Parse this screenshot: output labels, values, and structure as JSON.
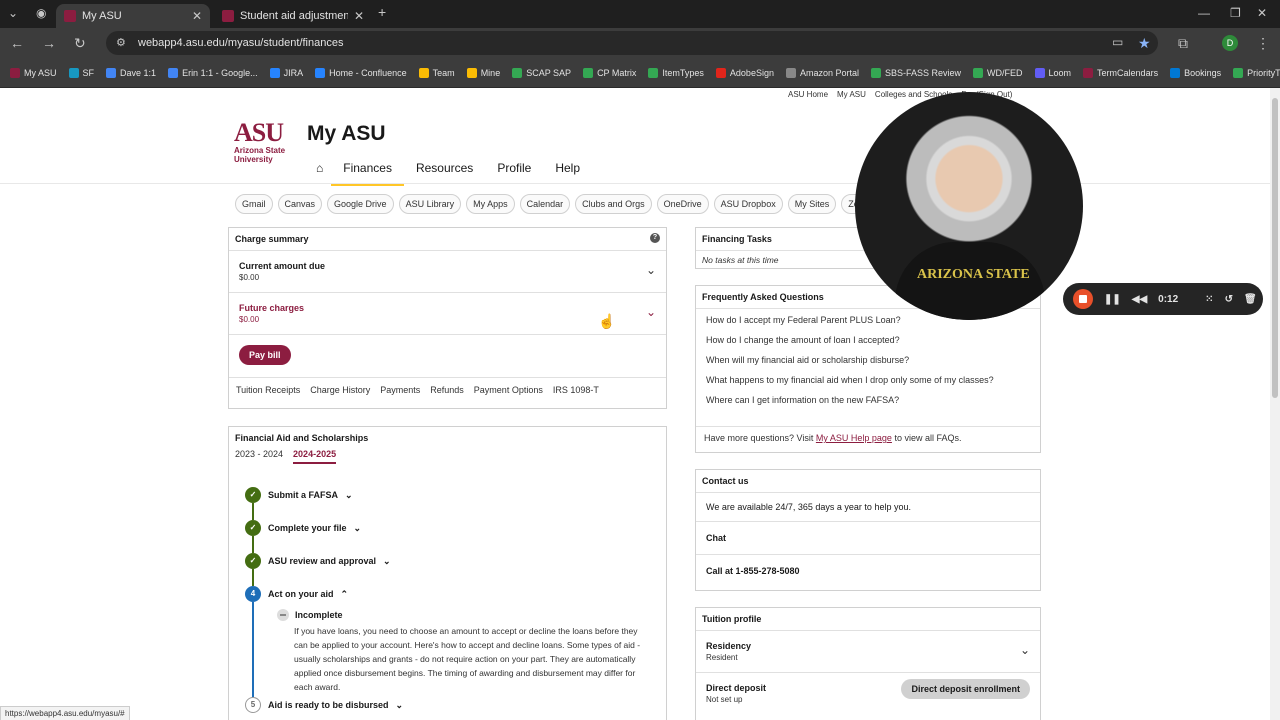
{
  "browser": {
    "tabs": [
      {
        "title": "My ASU",
        "active": true
      },
      {
        "title": "Student aid adjustment & re",
        "active": false
      }
    ],
    "new_tab": "+",
    "url": "webapp4.asu.edu/myasu/student/finances",
    "profile_initial": "D",
    "bookmarks": [
      {
        "label": "My ASU",
        "color": "#8c1d40"
      },
      {
        "label": "SF",
        "color": "#1798c1"
      },
      {
        "label": "Dave 1:1",
        "color": "#4285f4"
      },
      {
        "label": "Erin 1:1 - Google...",
        "color": "#4285f4"
      },
      {
        "label": "JIRA",
        "color": "#2684ff"
      },
      {
        "label": "Home - Confluence",
        "color": "#2684ff"
      },
      {
        "label": "Team",
        "color": "#fbbc04"
      },
      {
        "label": "Mine",
        "color": "#fbbc04"
      },
      {
        "label": "SCAP SAP",
        "color": "#34a853"
      },
      {
        "label": "CP Matrix",
        "color": "#34a853"
      },
      {
        "label": "ItemTypes",
        "color": "#34a853"
      },
      {
        "label": "AdobeSign",
        "color": "#e1251b"
      },
      {
        "label": "Amazon Portal",
        "color": "#888888"
      },
      {
        "label": "SBS-FASS Review",
        "color": "#34a853"
      },
      {
        "label": "WD/FED",
        "color": "#34a853"
      },
      {
        "label": "Loom",
        "color": "#625df5"
      },
      {
        "label": "TermCalendars",
        "color": "#8c1d40"
      },
      {
        "label": "Bookings",
        "color": "#0078d4"
      },
      {
        "label": "PriorityTickets",
        "color": "#34a853"
      }
    ],
    "status_url": "https://webapp4.asu.edu/myasu/#"
  },
  "page": {
    "top_links": [
      "ASU Home",
      "My ASU",
      "Colleges and Schools",
      "D... (Sign Out)"
    ],
    "logo": {
      "mark": "ASU",
      "line1": "Arizona State",
      "line2": "University"
    },
    "title": "My ASU",
    "nav": [
      "Finances",
      "Resources",
      "Profile",
      "Help"
    ],
    "pills": [
      "Gmail",
      "Canvas",
      "Google Drive",
      "ASU Library",
      "My Apps",
      "Calendar",
      "Clubs and Orgs",
      "OneDrive",
      "ASU Dropbox",
      "My Sites",
      "Ze"
    ]
  },
  "charge_summary": {
    "title": "Charge summary",
    "current_label": "Current amount due",
    "current_value": "$0.00",
    "future_label": "Future charges",
    "future_value": "$0.00",
    "pay_button": "Pay bill",
    "links": [
      "Tuition Receipts",
      "Charge History",
      "Payments",
      "Refunds",
      "Payment Options",
      "IRS 1098-T"
    ]
  },
  "aid": {
    "title": "Financial Aid and Scholarships",
    "years": [
      "2023 - 2024",
      "2024-2025"
    ],
    "steps": [
      {
        "label": "Submit a FAFSA",
        "state": "done",
        "glyph": "✓"
      },
      {
        "label": "Complete your file",
        "state": "done",
        "glyph": "✓"
      },
      {
        "label": "ASU review and approval",
        "state": "done",
        "glyph": "✓"
      },
      {
        "label": "Act on your aid",
        "state": "current",
        "glyph": "4"
      },
      {
        "label": "Aid is ready to be disbursed",
        "state": "todo",
        "glyph": "5"
      }
    ],
    "sub_status": "Incomplete",
    "sub_text": "If you have loans, you need to choose an amount to accept or decline the loans before they can be applied to your account. Here's how to accept and decline loans. Some types of aid - usually scholarships and grants - do not require action on your part. They are automatically applied once disbursement begins. The timing of awarding and disbursement may differ for each award."
  },
  "financing_tasks": {
    "title": "Financing Tasks",
    "empty": "No tasks at this time"
  },
  "faq": {
    "title": "Frequently Asked Questions",
    "questions": [
      "How do I accept my Federal Parent PLUS Loan?",
      "How do I change the amount of loan I accepted?",
      "When will my financial aid or scholarship disburse?",
      "What happens to my financial aid when I drop only some of my classes?",
      "Where can I get information on the new FAFSA?"
    ],
    "more_prefix": "Have more questions? Visit ",
    "more_link": "My ASU Help page",
    "more_suffix": " to view all FAQs."
  },
  "contact": {
    "title": "Contact us",
    "availability": "We are available 24/7, 365 days a year to help you.",
    "chat": "Chat",
    "call": "Call at 1-855-278-5080"
  },
  "tuition_profile": {
    "title": "Tuition profile",
    "residency_label": "Residency",
    "residency_value": "Resident",
    "deposit_label": "Direct deposit",
    "deposit_value": "Not set up",
    "deposit_button": "Direct deposit enrollment"
  },
  "recorder": {
    "timer": "0:12",
    "shirt_text": "ARIZONA STATE"
  }
}
